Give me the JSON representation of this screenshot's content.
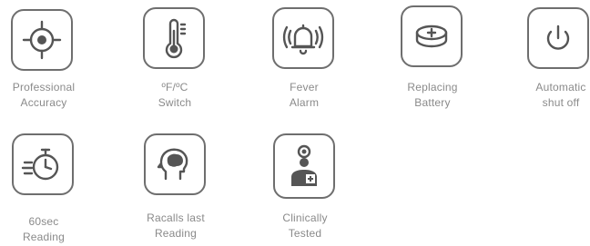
{
  "features": [
    {
      "icon": "crosshair-target-icon",
      "line1": "Professional",
      "line2": "Accuracy"
    },
    {
      "icon": "thermometer-icon",
      "line1": "ºF/ºC",
      "line2": "Switch"
    },
    {
      "icon": "alarm-bell-icon",
      "line1": "Fever",
      "line2": "Alarm"
    },
    {
      "icon": "coin-battery-icon",
      "line1": "Replacing",
      "line2": "Battery"
    },
    {
      "icon": "power-icon",
      "line1": "Automatic",
      "line2": "shut off"
    },
    {
      "icon": "stopwatch-speed-icon",
      "line1": "60sec",
      "line2": "Reading"
    },
    {
      "icon": "head-brain-memory-icon",
      "line1": "Racalls last",
      "line2": "Reading"
    },
    {
      "icon": "doctor-medical-icon",
      "line1": "Clinically",
      "line2": "Tested"
    }
  ]
}
